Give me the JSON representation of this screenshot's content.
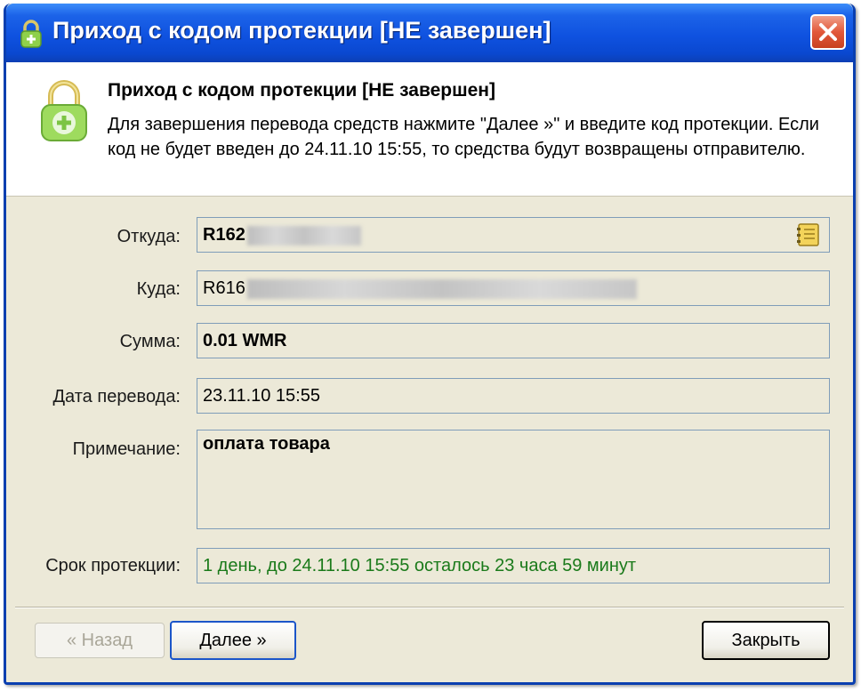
{
  "window": {
    "title": "Приход с кодом протекции [НЕ завершен]"
  },
  "header": {
    "title": "Приход с кодом протекции [НЕ завершен]",
    "description": "Для завершения перевода средств нажмите \"Далее »\" и введите код протекции. Если код не будет введен до 24.11.10 15:55, то средства будут возвращены отправителю."
  },
  "form": {
    "from_label": "Откуда:",
    "from_value": "R162",
    "to_label": "Куда:",
    "to_value": "R616",
    "amount_label": "Сумма:",
    "amount_value": "0.01 WMR",
    "date_label": "Дата перевода:",
    "date_value": "23.11.10 15:55",
    "note_label": "Примечание:",
    "note_value": "оплата товара",
    "protection_label": "Срок протекции:",
    "protection_value": "1 день, до 24.11.10 15:55 осталось 23 часа 59 минут"
  },
  "buttons": {
    "back": "« Назад",
    "next": "Далее »",
    "close": "Закрыть"
  },
  "colors": {
    "titlebar": "#0f52e0",
    "panel": "#ece9d8",
    "protection_text": "#1a7a1a",
    "field_border": "#7f9db9"
  },
  "icons": {
    "title": "padlock-icon",
    "header": "padlock-plus-icon",
    "address_book": "address-book-icon",
    "close": "close-icon"
  }
}
